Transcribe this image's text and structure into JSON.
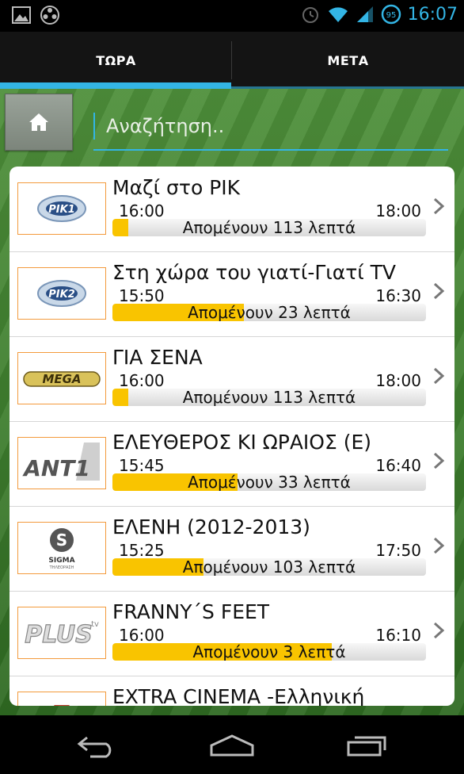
{
  "status_bar": {
    "time": "16:07",
    "battery_level": "95",
    "left_icons": [
      "picture-icon",
      "media-reel-icon"
    ],
    "right_icons": [
      "alarm-icon",
      "wifi-icon",
      "signal-icon",
      "battery-icon"
    ]
  },
  "tabs": [
    {
      "label": "ΤΩΡΑ",
      "selected": true
    },
    {
      "label": "ΜΕΤΑ",
      "selected": false
    }
  ],
  "search": {
    "placeholder": "Αναζήτηση..",
    "value": ""
  },
  "home_button": {
    "icon": "home-icon"
  },
  "programs": [
    {
      "channel": "RIK 1",
      "title": "Μαζί στο ΡΙΚ",
      "start": "16:00",
      "end": "18:00",
      "remaining": "Απομένουν 113 λεπτά",
      "progress": 0.05
    },
    {
      "channel": "RIK 2",
      "title": "Στη χώρα του γιατί-Γιατί TV",
      "start": "15:50",
      "end": "16:30",
      "remaining": "Απομένουν 23 λεπτά",
      "progress": 0.42
    },
    {
      "channel": "MEGA",
      "title": "ΓΙΑ ΣΕΝΑ",
      "start": "16:00",
      "end": "18:00",
      "remaining": "Απομένουν 113 λεπτά",
      "progress": 0.05
    },
    {
      "channel": "ANT1",
      "title": "ΕΛΕΥΘΕΡΟΣ ΚΙ ΩΡΑΙΟΣ (Ε)",
      "start": "15:45",
      "end": "16:40",
      "remaining": "Απομένουν 33 λεπτά",
      "progress": 0.4
    },
    {
      "channel": "SIGMA",
      "title": "ΕΛΕΝΗ (2012-2013)",
      "start": "15:25",
      "end": "17:50",
      "remaining": "Απομένουν 103 λεπτά",
      "progress": 0.29
    },
    {
      "channel": "PLUS TV",
      "title": "FRANNY´S FEET",
      "start": "16:00",
      "end": "16:10",
      "remaining": "Απομένουν 3 λεπτά",
      "progress": 0.7
    },
    {
      "channel": "EXTRA",
      "title": "EXTRA CINEMA -Ελληνική",
      "start": "",
      "end": "",
      "remaining": "",
      "progress": 0
    }
  ],
  "logo_texts": {
    "rik1": "ΡΙΚ1",
    "rik2": "ΡΙΚ2",
    "mega": "MEGA",
    "ant1": "ANT1",
    "sigma": "SIGMA",
    "sigma_sub": "ΤΗΛΕΟΡΑΣΗ",
    "plus": "PLUS",
    "plus_tv": "tv"
  },
  "nav": [
    {
      "icon": "back-icon"
    },
    {
      "icon": "home-nav-icon"
    },
    {
      "icon": "recent-apps-icon"
    }
  ],
  "colors": {
    "accent": "#33b5e5",
    "progress": "#f9c400",
    "logo_border": "#f39a3c",
    "background_green": "#3f7f2f"
  }
}
